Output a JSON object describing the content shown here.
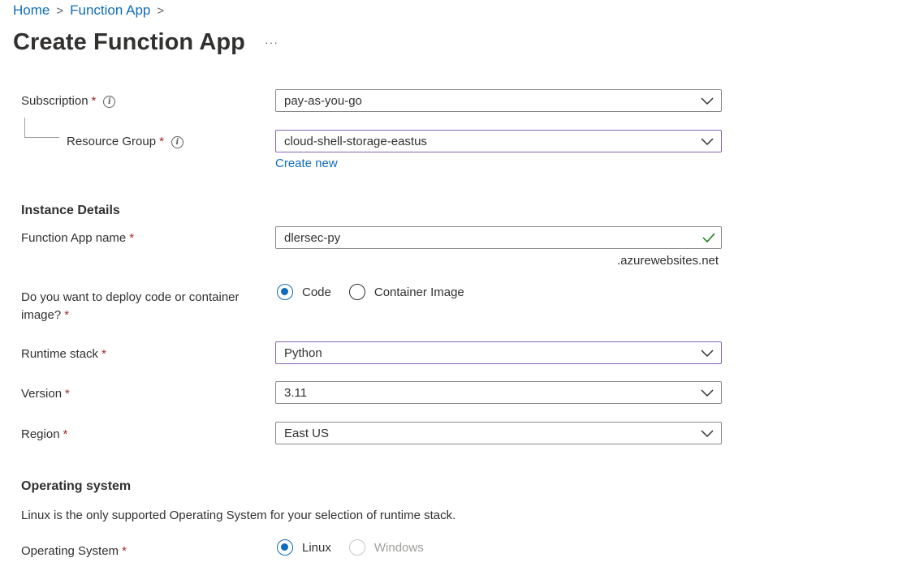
{
  "breadcrumb": {
    "home": "Home",
    "function_app": "Function App",
    "sep": ">"
  },
  "page": {
    "title": "Create Function App",
    "more": "···"
  },
  "required_mark": "*",
  "subscription": {
    "label": "Subscription",
    "value": "pay-as-you-go"
  },
  "resource_group": {
    "label": "Resource Group",
    "value": "cloud-shell-storage-eastus",
    "create_new": "Create new"
  },
  "instance_details": {
    "heading": "Instance Details",
    "name_label": "Function App name",
    "name_value": "dlersec-py",
    "name_suffix": ".azurewebsites.net",
    "deploy_label_line1": "Do you want to deploy code or container",
    "deploy_label_line2": "image?",
    "deploy_options": {
      "code": "Code",
      "container": "Container Image"
    },
    "runtime_label": "Runtime stack",
    "runtime_value": "Python",
    "version_label": "Version",
    "version_value": "3.11",
    "region_label": "Region",
    "region_value": "East US"
  },
  "operating_system": {
    "heading": "Operating system",
    "note": "Linux is the only supported Operating System for your selection of runtime stack.",
    "label": "Operating System",
    "options": {
      "linux": "Linux",
      "windows": "Windows"
    }
  },
  "colors": {
    "link": "#0f6cbd",
    "required": "#a4262c",
    "focus_border": "#8764b8",
    "valid_check": "#107c10"
  }
}
